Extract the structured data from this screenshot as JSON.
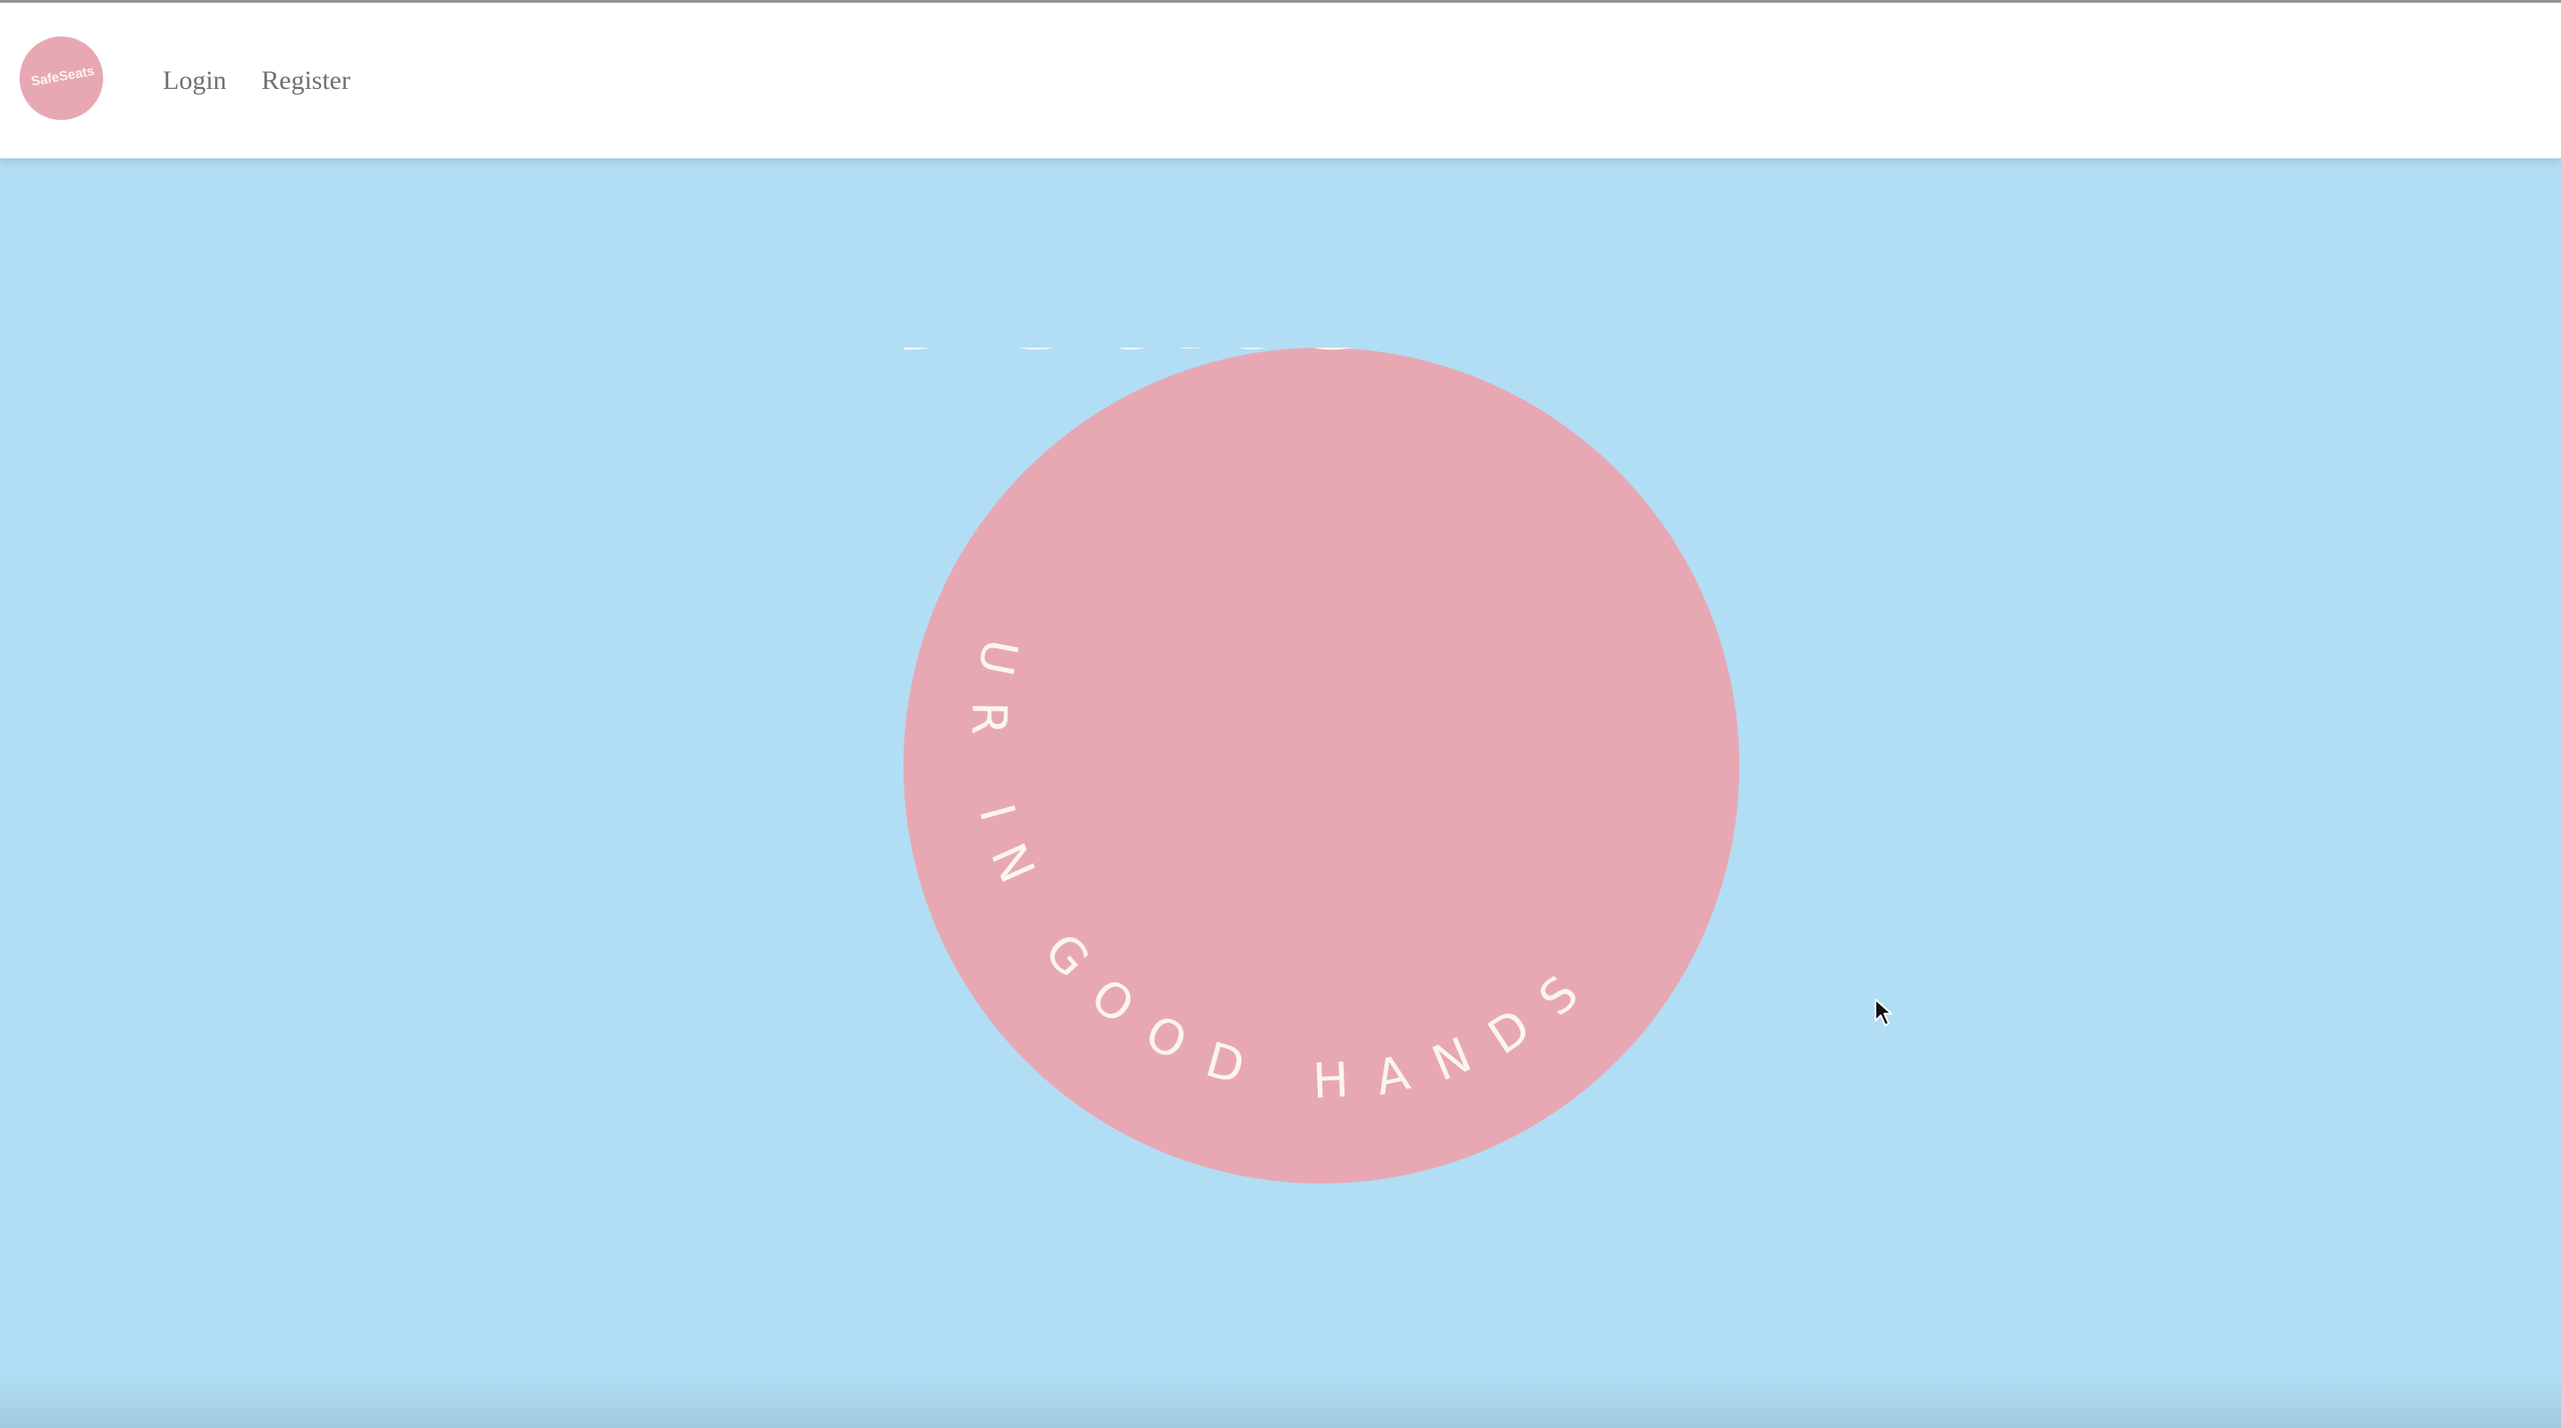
{
  "nav": {
    "logo_text": "SafeSeats",
    "login_label": "Login",
    "register_label": "Register"
  },
  "hero": {
    "brand": "SafeSeats",
    "tagline": "UR IN GOOD HANDS"
  },
  "colors": {
    "background": "#b1def5",
    "badge_pink": "#e8a8b3",
    "badge_text": "#fbf5f2",
    "nav_text": "#6f6f6f"
  },
  "icons": {
    "cursor": "mouse-pointer-icon"
  }
}
